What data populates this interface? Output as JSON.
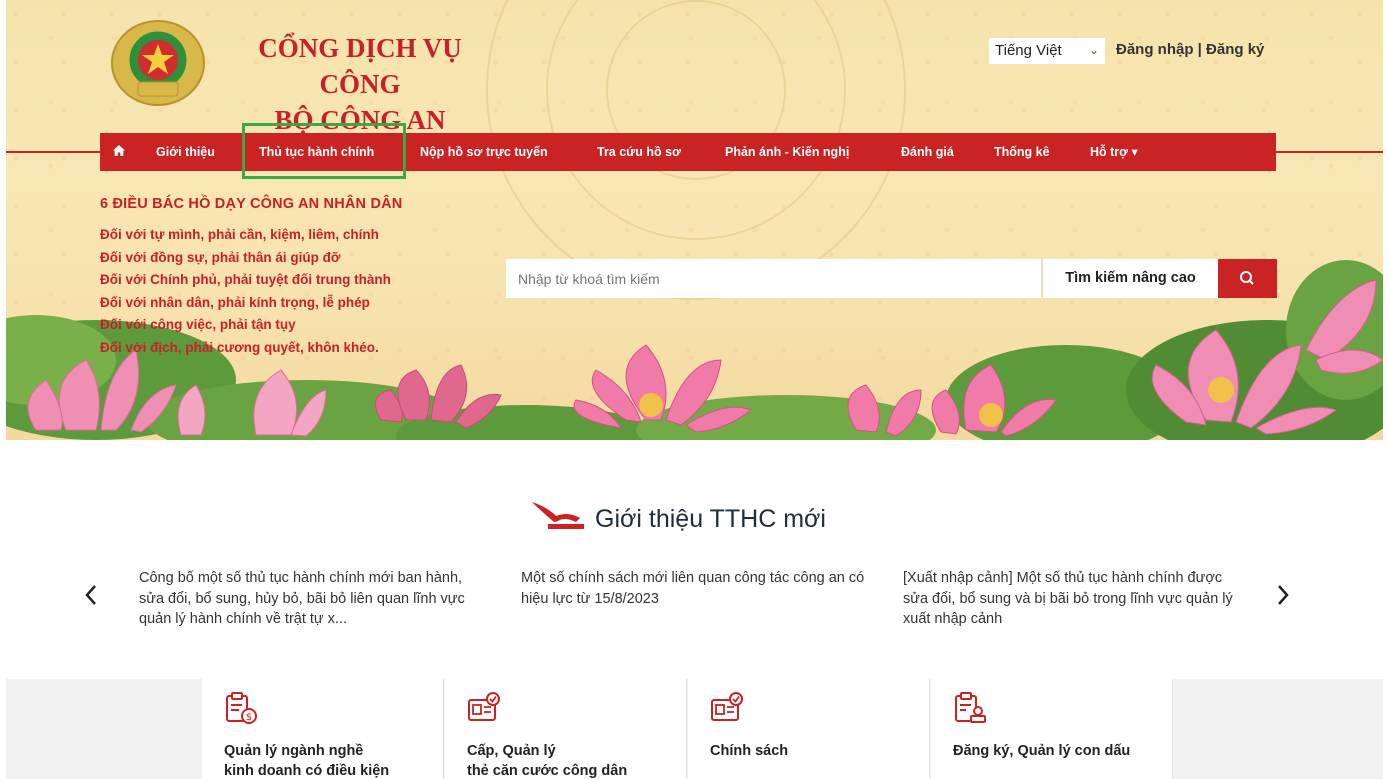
{
  "site": {
    "title_line1": "CỔNG DỊCH VỤ CÔNG",
    "title_line2": "BỘ CÔNG AN"
  },
  "header": {
    "language": "Tiếng Việt",
    "login": "Đăng nhập",
    "separator": " | ",
    "register": "Đăng ký"
  },
  "nav": {
    "items": [
      {
        "label": "Giới thiệu"
      },
      {
        "label": "Thủ tục hành chính"
      },
      {
        "label": "Nộp hồ sơ trực tuyến"
      },
      {
        "label": "Tra cứu hồ sơ"
      },
      {
        "label": "Phản ánh - Kiến nghị"
      },
      {
        "label": "Đánh giá"
      },
      {
        "label": "Thống kê"
      },
      {
        "label": "Hỗ trợ"
      }
    ],
    "home_icon": "home-icon",
    "highlight_color": "#3aa845"
  },
  "motto": {
    "title": "6 ĐIỀU BÁC HỒ DẠY CÔNG AN NHÂN DÂN",
    "lines": [
      "Đối với tự mình, phải cần, kiệm, liêm, chính",
      "Đối với đồng sự, phải thân ái giúp đỡ",
      "Đối với Chính phủ, phải tuyệt đối trung thành",
      "Đối với nhân dân, phải kính trọng, lễ phép",
      "Đối với công việc, phải tận tụy",
      "Đối với địch, phải cương quyết, khôn khéo."
    ]
  },
  "search": {
    "placeholder": "Nhập từ khoá tìm kiếm",
    "advanced_label": "Tìm kiếm nâng cao",
    "button_icon": "search-icon"
  },
  "tthc": {
    "title": "Giới thiệu TTHC mới",
    "news": [
      {
        "text": "Công bố một số thủ tục hành chính mới ban hành, sửa đổi, bổ sung, hủy bỏ, bãi bỏ liên quan lĩnh vực quản lý hành chính về trật tự x..."
      },
      {
        "text": "Một số chính sách mới liên quan công tác công an có hiệu lực từ 15/8/2023"
      },
      {
        "text": "[Xuất nhập cảnh] Một số thủ tục hành chính được sửa đổi, bổ sung và bị bãi bỏ trong lĩnh vực quản lý xuất nhập cảnh"
      }
    ],
    "prev_icon": "chevron-left-icon",
    "next_icon": "chevron-right-icon"
  },
  "categories": [
    {
      "label": "Quản lý ngành nghề\nkinh doanh có điều kiện",
      "icon": "clipboard-money-icon"
    },
    {
      "label": "Cấp, Quản lý\nthẻ căn cước công dân",
      "icon": "id-card-check-icon"
    },
    {
      "label": "Chính sách",
      "icon": "id-card-check-icon"
    },
    {
      "label": "Đăng ký, Quản lý con dấu",
      "icon": "clipboard-stamp-icon"
    }
  ],
  "colors": {
    "brand_red": "#c92323",
    "title_red": "#c8202b",
    "banner_bg": "#f7e2ad"
  }
}
